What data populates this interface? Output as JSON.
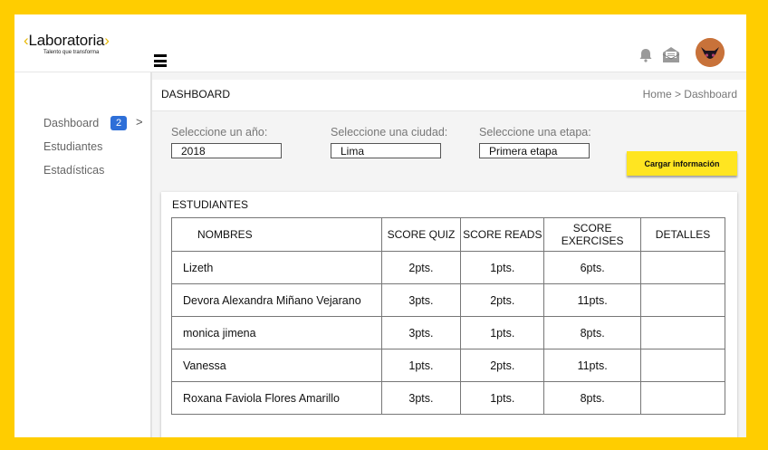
{
  "brand": {
    "logo_left": "‹",
    "logo_text": "Laboratoria",
    "logo_right": "›",
    "tagline": "Talento que transforma"
  },
  "header": {
    "icons": [
      "menu-icon",
      "bell-icon",
      "mail-icon",
      "avatar"
    ]
  },
  "sidebar": {
    "items": [
      {
        "label": "Dashboard",
        "badge": "2",
        "arrow": ">"
      },
      {
        "label": "Estudiantes"
      },
      {
        "label": "Estadísticas"
      }
    ]
  },
  "page": {
    "title": "DASHBOARD",
    "breadcrumb": "Home > Dashboard"
  },
  "filters": {
    "year": {
      "label": "Seleccione un año:",
      "value": "2018"
    },
    "city": {
      "label": "Seleccione una ciudad:",
      "value": "Lima"
    },
    "stage": {
      "label": "Seleccione una etapa:",
      "value": "Primera etapa"
    },
    "load_button": "Cargar información"
  },
  "students": {
    "title": "ESTUDIANTES",
    "columns": [
      "NOMBRES",
      "SCORE QUIZ",
      "SCORE READS",
      "SCORE EXERCISES",
      "DETALLES"
    ],
    "rows": [
      {
        "name": "Lizeth",
        "quiz": "2pts.",
        "reads": "1pts.",
        "exercises": "6pts.",
        "details": ""
      },
      {
        "name": "Devora Alexandra Miñano Vejarano",
        "quiz": "3pts.",
        "reads": "2pts.",
        "exercises": "11pts.",
        "details": ""
      },
      {
        "name": "monica jimena",
        "quiz": "3pts.",
        "reads": "1pts.",
        "exercises": "8pts.",
        "details": ""
      },
      {
        "name": "Vanessa",
        "quiz": "1pts.",
        "reads": "2pts.",
        "exercises": "11pts.",
        "details": ""
      },
      {
        "name": "Roxana Faviola Flores Amarillo",
        "quiz": "3pts.",
        "reads": "1pts.",
        "exercises": "8pts.",
        "details": ""
      }
    ]
  },
  "colors": {
    "frame": "#ffcd00",
    "badge": "#2e6fd8",
    "button": "#ffe521",
    "avatar": "#c8723a"
  }
}
